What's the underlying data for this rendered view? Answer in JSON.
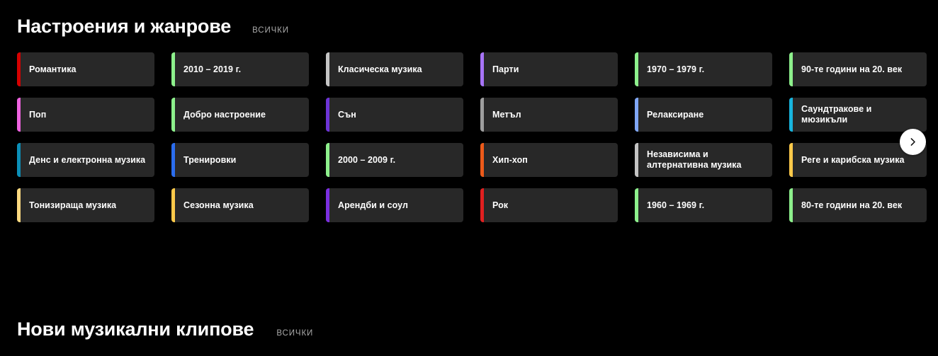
{
  "sections": [
    {
      "title": "Настроения и жанрове",
      "all_label": "ВСИЧКИ"
    },
    {
      "title": "Нови музикални клипове",
      "all_label": "ВСИЧКИ"
    }
  ],
  "next_button": {
    "name": "chevron-right-icon",
    "color": "#ffffff"
  },
  "card_style": {
    "background": "#282828",
    "text_color": "#ffffff"
  },
  "cards": [
    {
      "label": "Романтика",
      "accent": "#D50000"
    },
    {
      "label": "Поп",
      "accent": "#EE63E0"
    },
    {
      "label": "Денс и електронна музика",
      "accent": "#0B8FB8"
    },
    {
      "label": "Тонизираща музика",
      "accent": "#FCD980"
    },
    {
      "label": "2010 – 2019 г.",
      "accent": "#8DF08C"
    },
    {
      "label": "Добро настроение",
      "accent": "#8DF08C"
    },
    {
      "label": "Тренировки",
      "accent": "#2B6DEF"
    },
    {
      "label": "Сезонна музика",
      "accent": "#FCC94A"
    },
    {
      "label": "Класическа музика",
      "accent": "#C4C4C4"
    },
    {
      "label": "Сън",
      "accent": "#6D34D6"
    },
    {
      "label": "2000 – 2009 г.",
      "accent": "#8DF08C"
    },
    {
      "label": "Арендби и соул",
      "accent": "#7B2FE0"
    },
    {
      "label": "Парти",
      "accent": "#A774F7"
    },
    {
      "label": "Метъл",
      "accent": "#9E9E9E"
    },
    {
      "label": "Хип-хоп",
      "accent": "#EC5A1A"
    },
    {
      "label": "Рок",
      "accent": "#E02020"
    },
    {
      "label": "1970 – 1979 г.",
      "accent": "#8DF08C"
    },
    {
      "label": "Релаксиране",
      "accent": "#7FA6F5"
    },
    {
      "label": "Независима и алтернативна музика",
      "accent": "#C4C4C4"
    },
    {
      "label": "1960 – 1969 г.",
      "accent": "#8DF08C"
    },
    {
      "label": "90-те години на 20. век",
      "accent": "#8DF08C"
    },
    {
      "label": "Саундтракове и мюзикъли",
      "accent": "#18B5DE"
    },
    {
      "label": "Реге и карибска музика",
      "accent": "#FCC94A"
    },
    {
      "label": "80-те години на 20. век",
      "accent": "#8DF08C"
    }
  ]
}
